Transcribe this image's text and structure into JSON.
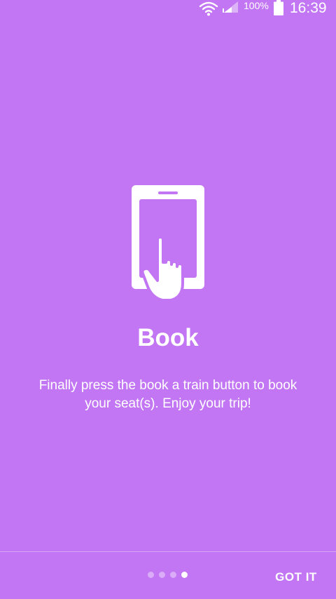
{
  "status_bar": {
    "battery_percent": "100%",
    "time": "16:39",
    "icons": [
      "wifi-icon",
      "signal-icon",
      "battery-icon"
    ]
  },
  "slide": {
    "icon": "phone-tap-icon",
    "title": "Book",
    "description": "Finally press the book a train button to book your seat(s). Enjoy your trip!"
  },
  "pager": {
    "total": 4,
    "current": 4
  },
  "actions": {
    "got_it_label": "GOT IT"
  },
  "colors": {
    "background": "#c276f3",
    "foreground": "#ffffff"
  }
}
